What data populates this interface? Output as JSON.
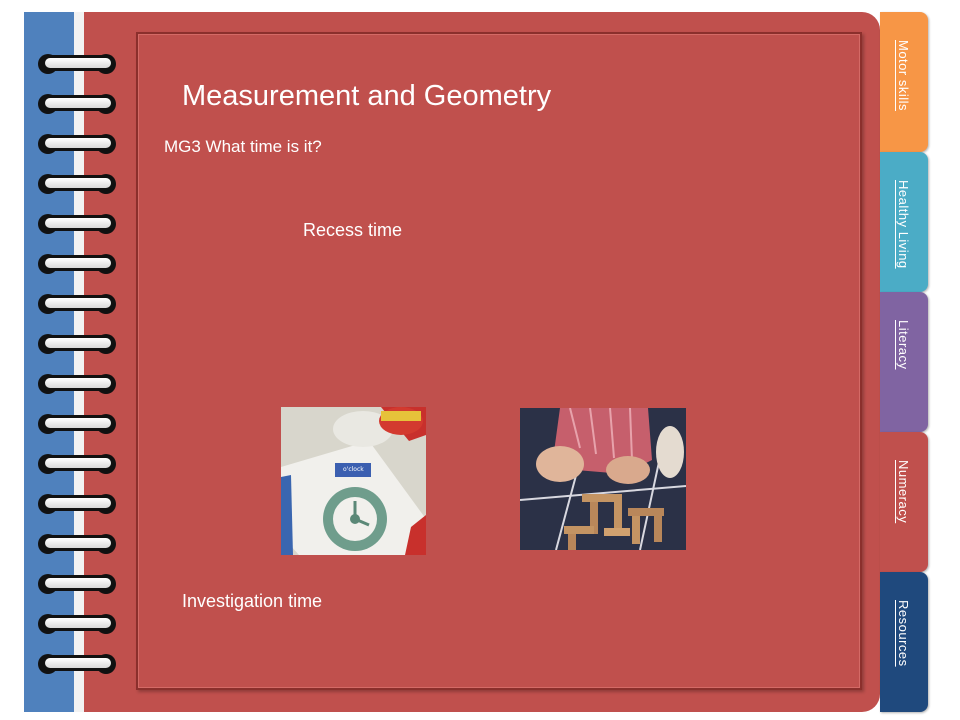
{
  "page": {
    "title": "Measurement and Geometry",
    "subtitle": "MG3 What time is it?",
    "captions": {
      "recess": "Recess time",
      "investigation": "Investigation time"
    }
  },
  "tabs": [
    {
      "label": "Motor skills",
      "color": "#f79646"
    },
    {
      "label": "Healthy Living",
      "color": "#4bacc6"
    },
    {
      "label": "Literacy",
      "color": "#8064a2"
    },
    {
      "label": "Numeracy",
      "color": "#c0504d"
    },
    {
      "label": "Resources",
      "color": "#1f497d"
    }
  ],
  "colors": {
    "page": "#c0504d",
    "spine": "#4f81bd",
    "text": "#ffffff"
  },
  "binding": {
    "ring_count": 16
  }
}
